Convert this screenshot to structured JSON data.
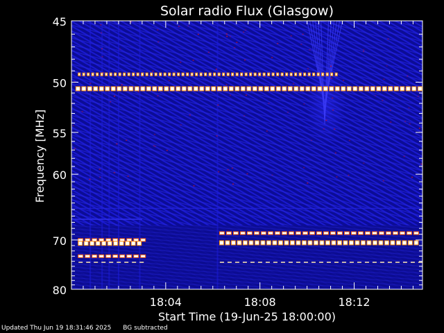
{
  "footer": {
    "updated": "Updated Thu Jun 19 18:31:46 2025",
    "note": "BG subtracted"
  },
  "chart_data": {
    "type": "heatmap",
    "title": "Solar radio Flux (Glasgow)",
    "xlabel": "Start Time (19-Jun-25 18:00:00)",
    "ylabel": "Frequency [MHz]",
    "x_unit": "minutes after 18:00",
    "xlim": [
      0,
      14.9
    ],
    "ylim": [
      80,
      45
    ],
    "y_scale": "reciprocal",
    "x_ticks": [
      {
        "value": 4,
        "label": "18:04"
      },
      {
        "value": 8,
        "label": "18:08"
      },
      {
        "value": 12,
        "label": "18:12"
      }
    ],
    "y_ticks": [
      {
        "value": 45,
        "label": "45"
      },
      {
        "value": 50,
        "label": "50"
      },
      {
        "value": 55,
        "label": "55"
      },
      {
        "value": 60,
        "label": "60"
      },
      {
        "value": 70,
        "label": "70"
      },
      {
        "value": 80,
        "label": "80"
      }
    ],
    "grid": false,
    "colors": {
      "background": "#0a0a8c",
      "high": "#ffffff",
      "mid": "#ff8c00",
      "low": "#c8102e"
    },
    "bands": [
      {
        "freq": 49.3,
        "start": 0.3,
        "end": 11.3,
        "style": "dash-fine"
      },
      {
        "freq": 50.6,
        "start": 0.2,
        "end": 14.8,
        "style": "dash-bold"
      },
      {
        "freq": 68.8,
        "start": 6.3,
        "end": 14.8,
        "style": "dash-medium"
      },
      {
        "freq": 70.5,
        "start": 6.3,
        "end": 14.8,
        "style": "dash-bold"
      },
      {
        "freq": 74.2,
        "start": 6.3,
        "end": 14.8,
        "style": "dash-thin"
      },
      {
        "freq": 70.0,
        "start": 0.3,
        "end": 3.0,
        "style": "dash-medium"
      },
      {
        "freq": 70.6,
        "start": 0.3,
        "end": 3.0,
        "style": "dash-bold"
      },
      {
        "freq": 73.0,
        "start": 0.3,
        "end": 3.0,
        "style": "dash-medium"
      },
      {
        "freq": 74.2,
        "start": 0.3,
        "end": 3.0,
        "style": "dash-thin"
      }
    ]
  }
}
